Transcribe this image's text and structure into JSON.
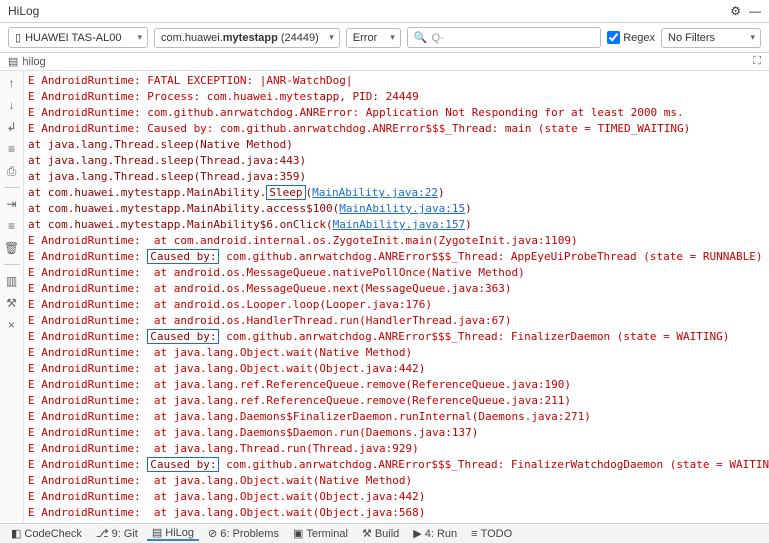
{
  "title": "HiLog",
  "toolbar": {
    "device": "HUAWEI TAS-AL00",
    "app_prefix": "com.huawei.",
    "app_bold": "mytestapp",
    "app_suffix": " (24449)",
    "level": "Error",
    "search_hint": "Q-",
    "regex_label": "Regex",
    "regex_checked": true,
    "filter": "No Filters"
  },
  "subbar": {
    "tab": "hilog"
  },
  "sidebar": [
    {
      "name": "arrow-up-icon",
      "g": "↑"
    },
    {
      "name": "arrow-down-icon",
      "g": "↓"
    },
    {
      "name": "wrap-icon",
      "g": "↲"
    },
    {
      "name": "settings-lines-icon",
      "g": "≡"
    },
    {
      "name": "print-icon",
      "g": "⎙"
    },
    {
      "sep": true
    },
    {
      "name": "collapse-icon",
      "g": "⇥"
    },
    {
      "name": "settings-lines2-icon",
      "g": "≡"
    },
    {
      "name": "trash-icon",
      "g": "🗑"
    },
    {
      "sep": true
    },
    {
      "name": "columns-icon",
      "g": "▥"
    },
    {
      "name": "tools-icon",
      "g": "⚒"
    },
    {
      "name": "close-icon",
      "g": "×"
    }
  ],
  "log": [
    {
      "t": "E AndroidRuntime: FATAL EXCEPTION: |ANR-WatchDog|"
    },
    {
      "t": "E AndroidRuntime: Process: com.huawei.mytestapp, PID: 24449"
    },
    {
      "t": "E AndroidRuntime: com.github.anrwatchdog.ANRError: Application Not Responding for at least 2000 ms."
    },
    {
      "t": "E AndroidRuntime: Caused by: com.github.anrwatchdog.ANRError$$$_Thread: main (state = TIMED_WAITING)"
    },
    {
      "cls": "dark",
      "t": "at java.lang.Thread.sleep(Native Method)"
    },
    {
      "cls": "dark",
      "t": "at java.lang.Thread.sleep(Thread.java:443)"
    },
    {
      "cls": "dark",
      "t": "at java.lang.Thread.sleep(Thread.java:359)"
    },
    {
      "cls": "dark",
      "segs": [
        {
          "t": "at com.huawei.mytestapp.MainAbility."
        },
        {
          "box": "Sleep"
        },
        {
          "t": "("
        },
        {
          "link": "MainAbility.java:22"
        },
        {
          "t": ")"
        }
      ]
    },
    {
      "cls": "dark",
      "segs": [
        {
          "t": "at com.huawei.mytestapp.MainAbility.access$100("
        },
        {
          "link": "MainAbility.java:15"
        },
        {
          "t": ")"
        }
      ]
    },
    {
      "cls": "dark",
      "segs": [
        {
          "t": "at com.huawei.mytestapp.MainAbility$6.onClick("
        },
        {
          "link": "MainAbility.java:157"
        },
        {
          "t": ")"
        }
      ]
    },
    {
      "t": "E AndroidRuntime:  at com.android.internal.os.ZygoteInit.main(ZygoteInit.java:1109)"
    },
    {
      "segs": [
        {
          "t": "E AndroidRuntime: "
        },
        {
          "box": "Caused by:"
        },
        {
          "t": " com.github.anrwatchdog.ANRError$$$_Thread: AppEyeUiProbeThread (state = RUNNABLE)"
        }
      ]
    },
    {
      "t": "E AndroidRuntime:  at android.os.MessageQueue.nativePollOnce(Native Method)"
    },
    {
      "t": "E AndroidRuntime:  at android.os.MessageQueue.next(MessageQueue.java:363)"
    },
    {
      "t": "E AndroidRuntime:  at android.os.Looper.loop(Looper.java:176)"
    },
    {
      "t": "E AndroidRuntime:  at android.os.HandlerThread.run(HandlerThread.java:67)"
    },
    {
      "segs": [
        {
          "t": "E AndroidRuntime: "
        },
        {
          "box": "Caused by:"
        },
        {
          "t": " com.github.anrwatchdog.ANRError$$$_Thread: FinalizerDaemon (state = WAITING)"
        }
      ]
    },
    {
      "t": "E AndroidRuntime:  at java.lang.Object.wait(Native Method)"
    },
    {
      "t": "E AndroidRuntime:  at java.lang.Object.wait(Object.java:442)"
    },
    {
      "t": "E AndroidRuntime:  at java.lang.ref.ReferenceQueue.remove(ReferenceQueue.java:190)"
    },
    {
      "t": "E AndroidRuntime:  at java.lang.ref.ReferenceQueue.remove(ReferenceQueue.java:211)"
    },
    {
      "t": "E AndroidRuntime:  at java.lang.Daemons$FinalizerDaemon.runInternal(Daemons.java:271)"
    },
    {
      "t": "E AndroidRuntime:  at java.lang.Daemons$Daemon.run(Daemons.java:137)"
    },
    {
      "t": "E AndroidRuntime:  at java.lang.Thread.run(Thread.java:929)"
    },
    {
      "segs": [
        {
          "t": "E AndroidRuntime: "
        },
        {
          "box": "Caused by:"
        },
        {
          "t": " com.github.anrwatchdog.ANRError$$$_Thread: FinalizerWatchdogDaemon (state = WAITIN"
        }
      ]
    },
    {
      "t": "E AndroidRuntime:  at java.lang.Object.wait(Native Method)"
    },
    {
      "t": "E AndroidRuntime:  at java.lang.Object.wait(Object.java:442)"
    },
    {
      "t": "E AndroidRuntime:  at java.lang.Object.wait(Object.java:568)"
    }
  ],
  "footer": [
    {
      "name": "codecheck",
      "icon": "◧",
      "label": "CodeCheck"
    },
    {
      "name": "git",
      "icon": "⎇",
      "label": "9: Git"
    },
    {
      "name": "hilog",
      "icon": "▤",
      "label": "HiLog",
      "on": true
    },
    {
      "name": "problems",
      "icon": "⊘",
      "label": "6: Problems"
    },
    {
      "name": "terminal",
      "icon": "▣",
      "label": "Terminal"
    },
    {
      "name": "build",
      "icon": "⚒",
      "label": "Build"
    },
    {
      "name": "run",
      "icon": "▶",
      "label": "4: Run"
    },
    {
      "name": "todo",
      "icon": "≡",
      "label": "TODO"
    }
  ]
}
